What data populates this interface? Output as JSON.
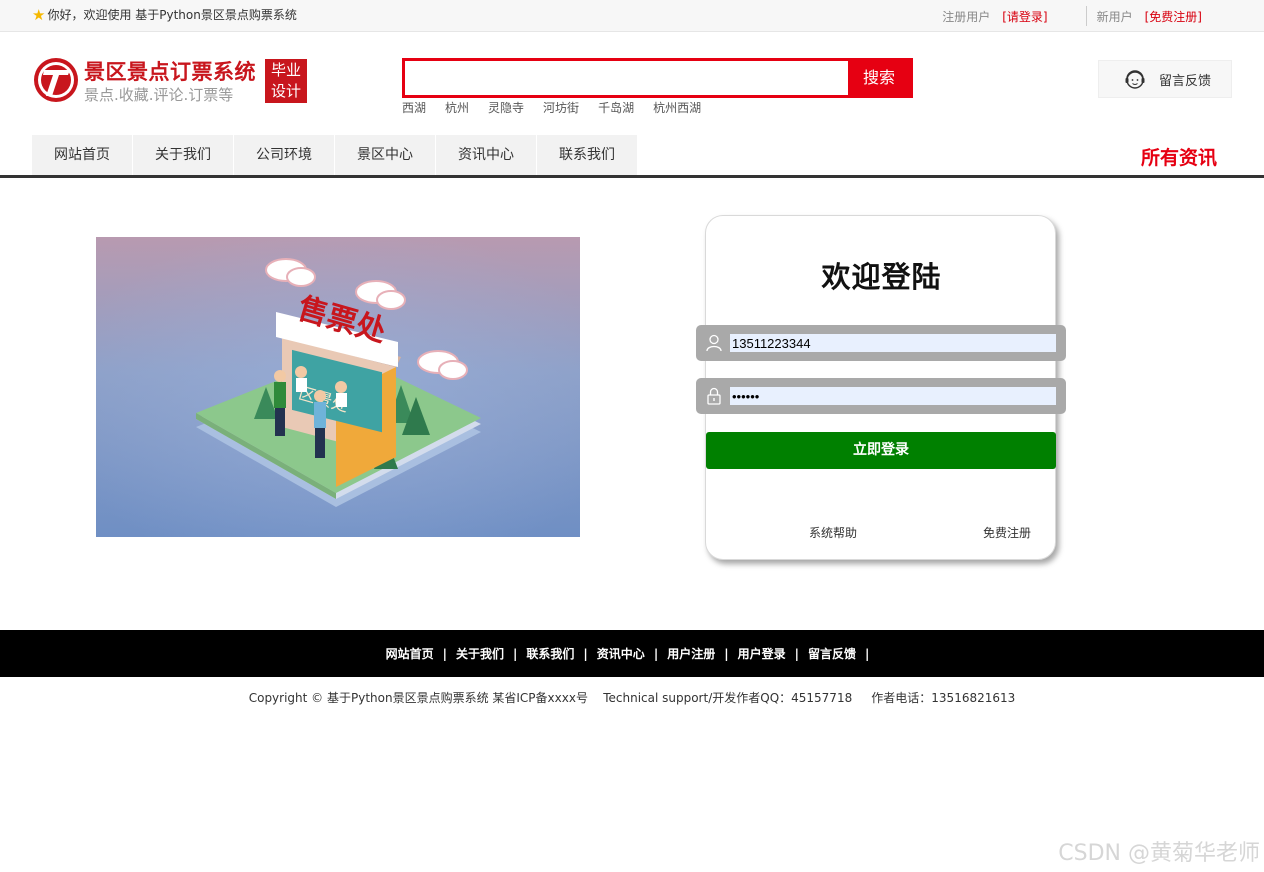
{
  "topbar": {
    "welcome": "你好，欢迎使用 基于Python景区景点购票系统",
    "registered_label": "注册用户",
    "login_link": "[请登录]",
    "new_user_label": "新用户",
    "register_link": "[免费注册]"
  },
  "header": {
    "logo_title": "景区景点订票系统",
    "logo_subtitle": "景点.收藏.评论.订票等",
    "badge_line1": "毕业",
    "badge_line2": "设计",
    "search_value": "",
    "search_button": "搜索",
    "hot_words": [
      "西湖",
      "杭州",
      "灵隐寺",
      "河坊街",
      "千岛湖",
      "杭州西湖"
    ],
    "feedback_label": "留言反馈"
  },
  "nav": {
    "items": [
      "网站首页",
      "关于我们",
      "公司环境",
      "景区中心",
      "资讯中心",
      "联系我们"
    ],
    "right_link": "所有资讯"
  },
  "hero": {
    "sign_text": "售票处",
    "counter_text": "区景处"
  },
  "login": {
    "title": "欢迎登陆",
    "username_value": "13511223344",
    "password_value": "••••••",
    "submit_label": "立即登录",
    "help_link": "系统帮助",
    "register_link": "免费注册"
  },
  "footer": {
    "links": [
      "网站首页",
      "关于我们",
      "联系我们",
      "资讯中心",
      "用户注册",
      "用户登录",
      "留言反馈"
    ],
    "separator": "|",
    "copyright": "Copyright © 基于Python景区景点购票系统 某省ICP备xxxx号    Technical support/开发作者QQ：45157718     作者电话：13516821613"
  },
  "watermark": "CSDN @黄菊华老师",
  "colors": {
    "brand_red": "#c8161d",
    "search_red": "#e60012",
    "login_green": "#008000",
    "footer_black": "#000000"
  },
  "icons": {
    "top_star": "star-icon",
    "logo": "logo-mark-icon",
    "feedback": "customer-service-icon",
    "user_field": "user-icon",
    "password_field": "lock-icon"
  }
}
